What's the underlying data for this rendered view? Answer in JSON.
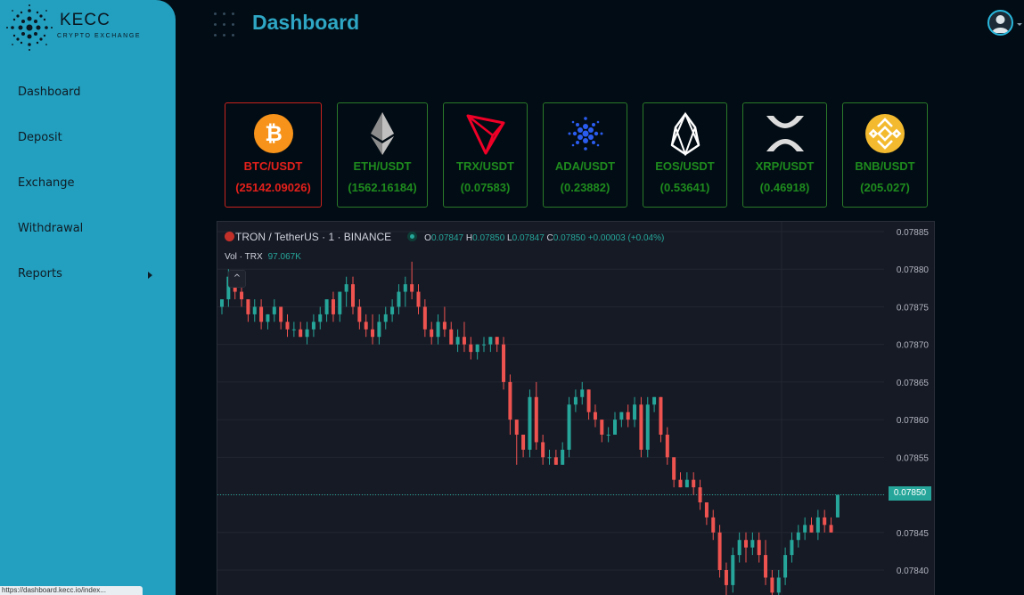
{
  "app": {
    "logo_title": "KECC",
    "logo_subtitle": "CRYPTO EXCHANGE",
    "page_title": "Dashboard",
    "status_url": "https://dashboard.kecc.io/index..."
  },
  "sidebar": {
    "items": [
      {
        "label": "Dashboard",
        "has_submenu": false
      },
      {
        "label": "Deposit",
        "has_submenu": false
      },
      {
        "label": "Exchange",
        "has_submenu": false
      },
      {
        "label": "Withdrawal",
        "has_submenu": false
      },
      {
        "label": "Reports",
        "has_submenu": true
      }
    ]
  },
  "tickers": [
    {
      "pair": "BTC/USDT",
      "price": "(25142.09026)",
      "icon": "bitcoin-icon",
      "active": true
    },
    {
      "pair": "ETH/USDT",
      "price": "(1562.16184)",
      "icon": "ethereum-icon",
      "active": false
    },
    {
      "pair": "TRX/USDT",
      "price": "(0.07583)",
      "icon": "tron-icon",
      "active": false
    },
    {
      "pair": "ADA/USDT",
      "price": "(0.23882)",
      "icon": "cardano-icon",
      "active": false
    },
    {
      "pair": "EOS/USDT",
      "price": "(0.53641)",
      "icon": "eos-icon",
      "active": false
    },
    {
      "pair": "XRP/USDT",
      "price": "(0.46918)",
      "icon": "xrp-icon",
      "active": false
    },
    {
      "pair": "BNB/USDT",
      "price": "(205.027)",
      "icon": "bnb-icon",
      "active": false
    }
  ],
  "chart": {
    "symbol": "TRON / TetherUS · 1 · BINANCE",
    "o_label": "O",
    "o": "0.07847",
    "h_label": "H",
    "h": "0.07850",
    "l_label": "L",
    "l": "0.07847",
    "c_label": "C",
    "c": "0.07850",
    "change": "+0.00003 (+0.04%)",
    "vol_label": "Vol · TRX",
    "vol_value": "97.067K",
    "collapse": "^",
    "last_price": "0.07850"
  },
  "colors": {
    "sidebar": "#239fbf",
    "accent": "#2ea6c4",
    "up": "#26a69a",
    "down": "#ef5350",
    "ticker_green": "#1e8b1e",
    "ticker_red": "#e3201b"
  },
  "chart_data": {
    "type": "candlestick",
    "y_ticks": [
      "0.07885",
      "0.07880",
      "0.07875",
      "0.07870",
      "0.07865",
      "0.07860",
      "0.07855",
      "0.07850",
      "0.07845",
      "0.07840"
    ],
    "ylim": [
      0.07837,
      0.07886
    ],
    "ohlc": [
      [
        0.07875,
        0.07876,
        0.07874,
        0.07876
      ],
      [
        0.07876,
        0.0788,
        0.07875,
        0.07879
      ],
      [
        0.07879,
        0.07879,
        0.07876,
        0.07877
      ],
      [
        0.07877,
        0.07878,
        0.07875,
        0.07876
      ],
      [
        0.07876,
        0.07876,
        0.07873,
        0.07874
      ],
      [
        0.07874,
        0.07876,
        0.07873,
        0.07875
      ],
      [
        0.07875,
        0.07876,
        0.07872,
        0.07873
      ],
      [
        0.07873,
        0.07874,
        0.07872,
        0.07874
      ],
      [
        0.07874,
        0.07876,
        0.07873,
        0.07875
      ],
      [
        0.07875,
        0.07875,
        0.07872,
        0.07873
      ],
      [
        0.07873,
        0.07874,
        0.07871,
        0.07872
      ],
      [
        0.07872,
        0.07873,
        0.07871,
        0.07872
      ],
      [
        0.07872,
        0.07873,
        0.07871,
        0.07871
      ],
      [
        0.07871,
        0.07873,
        0.0787,
        0.07872
      ],
      [
        0.07872,
        0.07874,
        0.07871,
        0.07873
      ],
      [
        0.07873,
        0.07875,
        0.07872,
        0.07874
      ],
      [
        0.07874,
        0.07876,
        0.07873,
        0.07876
      ],
      [
        0.07876,
        0.07877,
        0.07873,
        0.07874
      ],
      [
        0.07874,
        0.07877,
        0.07873,
        0.07877
      ],
      [
        0.07877,
        0.07879,
        0.07875,
        0.07878
      ],
      [
        0.07878,
        0.07879,
        0.07874,
        0.07875
      ],
      [
        0.07875,
        0.07876,
        0.07872,
        0.07873
      ],
      [
        0.07873,
        0.07874,
        0.07871,
        0.07872
      ],
      [
        0.07872,
        0.07874,
        0.0787,
        0.07871
      ],
      [
        0.07871,
        0.07874,
        0.0787,
        0.07873
      ],
      [
        0.07873,
        0.07875,
        0.07872,
        0.07874
      ],
      [
        0.07874,
        0.07876,
        0.07873,
        0.07875
      ],
      [
        0.07875,
        0.07878,
        0.07874,
        0.07877
      ],
      [
        0.07877,
        0.07879,
        0.07875,
        0.07878
      ],
      [
        0.07878,
        0.07881,
        0.07876,
        0.07877
      ],
      [
        0.07877,
        0.07878,
        0.07874,
        0.07875
      ],
      [
        0.07875,
        0.07876,
        0.07871,
        0.07872
      ],
      [
        0.07872,
        0.07873,
        0.0787,
        0.07871
      ],
      [
        0.07871,
        0.07874,
        0.0787,
        0.07873
      ],
      [
        0.07873,
        0.07875,
        0.07871,
        0.07872
      ],
      [
        0.07872,
        0.07873,
        0.0787,
        0.0787
      ],
      [
        0.0787,
        0.07872,
        0.07869,
        0.07871
      ],
      [
        0.07871,
        0.07873,
        0.07869,
        0.0787
      ],
      [
        0.0787,
        0.07871,
        0.07868,
        0.07869
      ],
      [
        0.07869,
        0.0787,
        0.07868,
        0.0787
      ],
      [
        0.0787,
        0.07871,
        0.07869,
        0.0787
      ],
      [
        0.0787,
        0.07871,
        0.07869,
        0.07871
      ],
      [
        0.07871,
        0.07871,
        0.07869,
        0.0787
      ],
      [
        0.0787,
        0.07871,
        0.07864,
        0.07865
      ],
      [
        0.07865,
        0.07866,
        0.07858,
        0.0786
      ],
      [
        0.0786,
        0.0786,
        0.07854,
        0.07858
      ],
      [
        0.07858,
        0.07858,
        0.07855,
        0.07856
      ],
      [
        0.07856,
        0.07864,
        0.07855,
        0.07863
      ],
      [
        0.07863,
        0.07865,
        0.07856,
        0.07857
      ],
      [
        0.07857,
        0.07858,
        0.07854,
        0.07855
      ],
      [
        0.07855,
        0.07856,
        0.07854,
        0.07855
      ],
      [
        0.07855,
        0.07856,
        0.07854,
        0.07854
      ],
      [
        0.07854,
        0.07857,
        0.07854,
        0.07856
      ],
      [
        0.07856,
        0.07863,
        0.07855,
        0.07862
      ],
      [
        0.07862,
        0.07864,
        0.07861,
        0.07863
      ],
      [
        0.07863,
        0.07865,
        0.07862,
        0.07864
      ],
      [
        0.07864,
        0.07864,
        0.0786,
        0.07861
      ],
      [
        0.07861,
        0.07862,
        0.07859,
        0.0786
      ],
      [
        0.0786,
        0.0786,
        0.07857,
        0.07858
      ],
      [
        0.07858,
        0.07859,
        0.07857,
        0.07858
      ],
      [
        0.07858,
        0.07861,
        0.07858,
        0.0786
      ],
      [
        0.0786,
        0.07861,
        0.07859,
        0.07861
      ],
      [
        0.07861,
        0.07862,
        0.07859,
        0.0786
      ],
      [
        0.0786,
        0.07863,
        0.07859,
        0.07862
      ],
      [
        0.07862,
        0.07863,
        0.07855,
        0.07856
      ],
      [
        0.07856,
        0.07863,
        0.07855,
        0.07862
      ],
      [
        0.07862,
        0.07863,
        0.07861,
        0.07863
      ],
      [
        0.07863,
        0.07863,
        0.07857,
        0.07858
      ],
      [
        0.07858,
        0.07859,
        0.07854,
        0.07855
      ],
      [
        0.07855,
        0.07855,
        0.07851,
        0.07852
      ],
      [
        0.07852,
        0.07853,
        0.07851,
        0.07851
      ],
      [
        0.07851,
        0.07853,
        0.07851,
        0.07852
      ],
      [
        0.07852,
        0.07853,
        0.0785,
        0.07851
      ],
      [
        0.07851,
        0.07852,
        0.07848,
        0.07849
      ],
      [
        0.07849,
        0.07849,
        0.07846,
        0.07847
      ],
      [
        0.07847,
        0.07848,
        0.07844,
        0.07845
      ],
      [
        0.07845,
        0.07846,
        0.07839,
        0.0784
      ],
      [
        0.0784,
        0.07841,
        0.07836,
        0.07838
      ],
      [
        0.07838,
        0.07843,
        0.07837,
        0.07842
      ],
      [
        0.07842,
        0.07845,
        0.07841,
        0.07844
      ],
      [
        0.07844,
        0.07845,
        0.07841,
        0.07843
      ],
      [
        0.07843,
        0.07845,
        0.07842,
        0.07844
      ],
      [
        0.07844,
        0.07845,
        0.07841,
        0.07842
      ],
      [
        0.07842,
        0.07844,
        0.07838,
        0.07839
      ],
      [
        0.07839,
        0.0784,
        0.07836,
        0.07837
      ],
      [
        0.07837,
        0.0784,
        0.07836,
        0.07839
      ],
      [
        0.07839,
        0.07843,
        0.07838,
        0.07842
      ],
      [
        0.07842,
        0.07845,
        0.07841,
        0.07844
      ],
      [
        0.07844,
        0.07846,
        0.07843,
        0.07845
      ],
      [
        0.07845,
        0.07847,
        0.07844,
        0.07846
      ],
      [
        0.07846,
        0.07847,
        0.07845,
        0.07845
      ],
      [
        0.07845,
        0.07848,
        0.07844,
        0.07847
      ],
      [
        0.07847,
        0.07848,
        0.07845,
        0.07846
      ],
      [
        0.07846,
        0.07847,
        0.07845,
        0.07845
      ],
      [
        0.07847,
        0.0785,
        0.07847,
        0.0785
      ]
    ]
  }
}
